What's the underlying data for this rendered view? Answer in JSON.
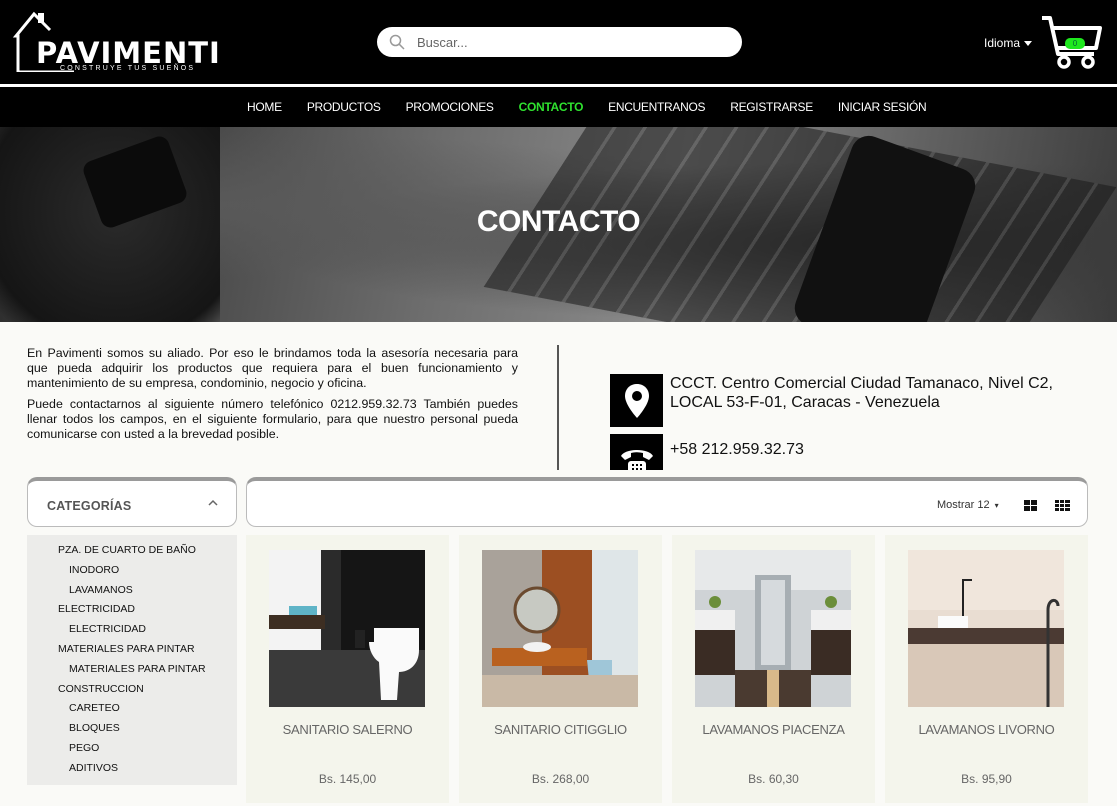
{
  "brand": {
    "name": "PAVIMENTI",
    "tagline": "CONSTRUYE TUS SUEÑOS"
  },
  "search": {
    "placeholder": "Buscar..."
  },
  "language": {
    "label": "Idioma"
  },
  "cart": {
    "count": "0"
  },
  "nav": {
    "items": [
      "HOME",
      "PRODUCTOS",
      "PROMOCIONES",
      "CONTACTO",
      "ENCUENTRANOS",
      "REGISTRARSE",
      "INICIAR SESIÓN"
    ],
    "active": "CONTACTO"
  },
  "hero": {
    "title": "CONTACTO"
  },
  "info": {
    "p1": "En Pavimenti somos su aliado. Por eso le brindamos toda la asesoría necesaria para que pueda adquirir los productos que requiera para el buen funcionamiento y mantenimiento de su empresa, condominio, negocio y oficina.",
    "p2": "Puede contactarnos al siguiente número telefónico 0212.959.32.73 También puedes llenar todos los campos, en el siguiente formulario, para que nuestro personal pueda comunicarse con usted a la brevedad posible."
  },
  "contact": {
    "address": "CCCT. Centro Comercial Ciudad Tamanaco, Nivel C2, LOCAL 53-F-01, Caracas - Venezuela",
    "phone": "+58 212.959.32.73"
  },
  "categories": {
    "title": "CATEGORÍAS",
    "items": [
      {
        "label": "PZA. DE CUARTO DE BAÑO",
        "level": 1
      },
      {
        "label": "INODORO",
        "level": 2
      },
      {
        "label": "LAVAMANOS",
        "level": 2
      },
      {
        "label": "ELECTRICIDAD",
        "level": 1
      },
      {
        "label": "ELECTRICIDAD",
        "level": 2
      },
      {
        "label": "MATERIALES PARA PINTAR",
        "level": 1
      },
      {
        "label": "MATERIALES PARA PINTAR",
        "level": 2
      },
      {
        "label": "CONSTRUCCION",
        "level": 1
      },
      {
        "label": "CARETEO",
        "level": 2
      },
      {
        "label": "BLOQUES",
        "level": 2
      },
      {
        "label": "PEGO",
        "level": 2
      },
      {
        "label": "ADITIVOS",
        "level": 2
      }
    ]
  },
  "toolbar": {
    "show_label": "Mostrar 12"
  },
  "products": [
    {
      "name": "SANITARIO SALERNO",
      "price": "Bs. 145,00"
    },
    {
      "name": "SANITARIO CITIGGLIO",
      "price": "Bs. 268,00"
    },
    {
      "name": "LAVAMANOS PIACENZA",
      "price": "Bs. 60,30"
    },
    {
      "name": "LAVAMANOS LIVORNO",
      "price": "Bs. 95,90"
    }
  ],
  "colors": {
    "accent": "#2fe12f",
    "header_bg": "#000000",
    "card_bg": "#f4f5ec"
  },
  "icons": [
    "house-logo-icon",
    "search-icon",
    "caret-down-icon",
    "cart-icon",
    "map-pin-icon",
    "phone-icon",
    "chevron-up-icon",
    "grid-large-icon",
    "grid-small-icon"
  ]
}
